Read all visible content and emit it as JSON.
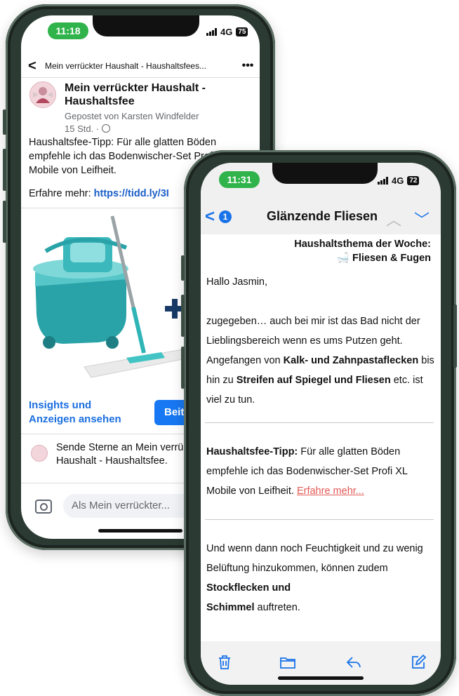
{
  "phone1": {
    "status_time": "11:18",
    "network": "4G",
    "battery": "75",
    "nav": {
      "title": "Mein verrückter Haushalt - Haushaltsfees...",
      "more": "•••"
    },
    "post": {
      "page_name": "Mein verrückter Haushalt - Haushaltsfee",
      "posted_by": "Gepostet von Karsten Windfelder",
      "time": "15 Std. · ",
      "text": "Haushaltsfee-Tipp: Für alle glatten Böden empfehle ich das Bodenwischer-Set Profi XL Mobile von Leifheit.",
      "more_prefix": "Erfahre mehr: ",
      "more_link": "https://tidd.ly/3I"
    },
    "actions": {
      "insights": "Insights und Anzeigen ansehen",
      "boost": "Beitr"
    },
    "stars": "Sende Sterne an Mein verrückter Haushalt - Haushaltsfee.",
    "composer_placeholder": "Als Mein verrückter..."
  },
  "phone2": {
    "status_time": "11:31",
    "network": "4G",
    "battery": "72",
    "nav": {
      "unread": "1",
      "subject": "Glänzende Fliesen"
    },
    "header_line1": "Haushaltsthema der Woche:",
    "header_line2": "🛁 Fliesen & Fugen",
    "greeting": "Hallo Jasmin,",
    "p1_a": "zugegeben… auch bei mir ist das Bad nicht der Lieblingsbereich wenn es ums Putzen geht. Angefangen von ",
    "p1_b": "Kalk- und Zahnpastaflecken",
    "p1_c": " bis hin zu ",
    "p1_d": "Streifen auf Spiegel und Fliesen",
    "p1_e": " etc. ist viel zu tun.",
    "p2_a": "Haushaltsfee-Tipp:",
    "p2_b": " Für alle glatten Böden empfehle ich das Bodenwischer-Set Profi XL Mobile von Leifheit. ",
    "p2_link": "Erfahre mehr...",
    "p3_a": "Und wenn dann noch Feuchtigkeit und zu wenig Belüftung hinzukommen, können zudem ",
    "p3_b": "Stockflecken und",
    "p3_c": "Schimmel",
    "p3_d": " auftreten."
  }
}
